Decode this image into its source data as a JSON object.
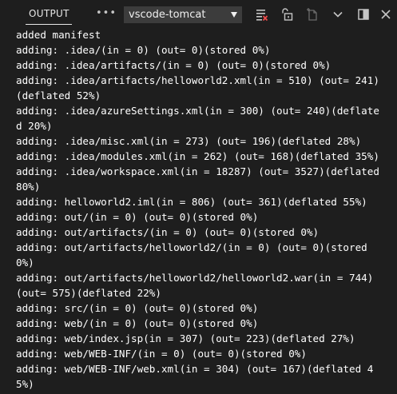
{
  "header": {
    "tab_label": "OUTPUT",
    "more_label": "•••",
    "channel_selected": "vscode-tomcat",
    "icons": [
      "clear-output-icon",
      "lock-scroll-icon",
      "open-log-file-icon",
      "chevron-down-icon",
      "maximize-panel-icon",
      "close-icon"
    ]
  },
  "colors": {
    "background": "#1e1e1e",
    "text": "#ffffff",
    "select_background": "#3c3c3c",
    "clear_icon_accent": "#f14c4c"
  },
  "log": {
    "lines": [
      "added manifest",
      "adding: .idea/(in = 0) (out= 0)(stored 0%)",
      "adding: .idea/artifacts/(in = 0) (out= 0)(stored 0%)",
      "adding: .idea/artifacts/helloworld2.xml(in = 510) (out= 241)(deflated 52%)",
      "adding: .idea/azureSettings.xml(in = 300) (out= 240)(deflated 20%)",
      "adding: .idea/misc.xml(in = 273) (out= 196)(deflated 28%)",
      "adding: .idea/modules.xml(in = 262) (out= 168)(deflated 35%)",
      "adding: .idea/workspace.xml(in = 18287) (out= 3527)(deflated 80%)",
      "adding: helloworld2.iml(in = 806) (out= 361)(deflated 55%)",
      "adding: out/(in = 0) (out= 0)(stored 0%)",
      "adding: out/artifacts/(in = 0) (out= 0)(stored 0%)",
      "adding: out/artifacts/helloworld2/(in = 0) (out= 0)(stored 0%)",
      "adding: out/artifacts/helloworld2/helloworld2.war(in = 744) (out= 575)(deflated 22%)",
      "adding: src/(in = 0) (out= 0)(stored 0%)",
      "adding: web/(in = 0) (out= 0)(stored 0%)",
      "adding: web/index.jsp(in = 307) (out= 223)(deflated 27%)",
      "adding: web/WEB-INF/(in = 0) (out= 0)(stored 0%)",
      "adding: web/WEB-INF/web.xml(in = 304) (out= 167)(deflated 45%)"
    ]
  }
}
